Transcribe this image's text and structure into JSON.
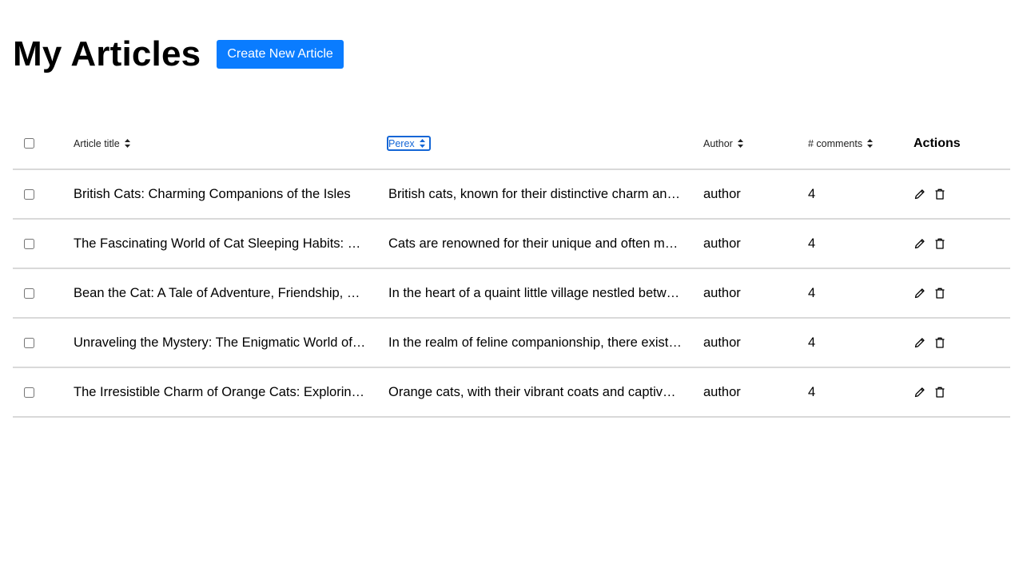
{
  "page": {
    "title": "My Articles",
    "create_button_label": "Create New Article"
  },
  "table": {
    "columns": [
      {
        "key": "select",
        "label": ""
      },
      {
        "key": "title",
        "label": "Article title"
      },
      {
        "key": "perex",
        "label": "Perex"
      },
      {
        "key": "author",
        "label": "Author"
      },
      {
        "key": "comments",
        "label": "# comments"
      },
      {
        "key": "actions",
        "label": "Actions"
      }
    ],
    "rows": [
      {
        "title": "British Cats: Charming Companions of the Isles",
        "perex": "British cats, known for their distinctive charm an…",
        "author": "author",
        "comments": "4"
      },
      {
        "title": "The Fascinating World of Cat Sleeping Habits: …",
        "perex": "Cats are renowned for their unique and often m…",
        "author": "author",
        "comments": "4"
      },
      {
        "title": "Bean the Cat: A Tale of Adventure, Friendship, …",
        "perex": "In the heart of a quaint little village nestled betw…",
        "author": "author",
        "comments": "4"
      },
      {
        "title": "Unraveling the Mystery: The Enigmatic World of…",
        "perex": "In the realm of feline companionship, there exist…",
        "author": "author",
        "comments": "4"
      },
      {
        "title": "The Irresistible Charm of Orange Cats: Explorin…",
        "perex": "Orange cats, with their vibrant coats and captiv…",
        "author": "author",
        "comments": "4"
      }
    ]
  },
  "icons": {
    "sort": "sort-icon",
    "edit": "pencil-icon",
    "delete": "trash-icon"
  },
  "colors": {
    "accent": "#0a7cff",
    "focus_ring": "#1466d6",
    "row_divider": "#d9d9d9"
  }
}
